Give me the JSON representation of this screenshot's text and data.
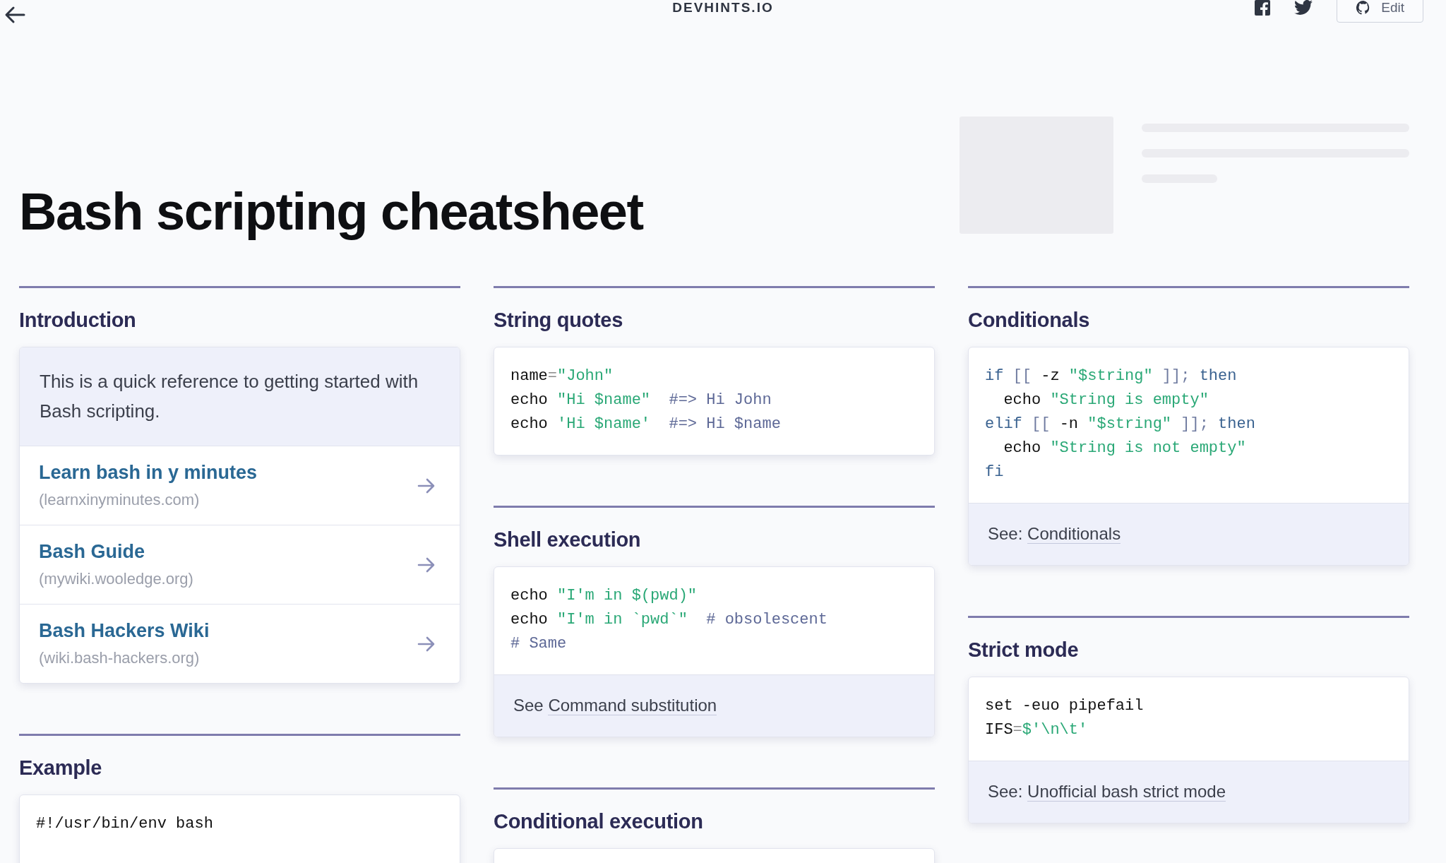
{
  "topbar": {
    "site": "DEVHINTS.IO",
    "edit_button": "Edit"
  },
  "title": "Bash scripting cheatsheet",
  "columns": [
    [
      {
        "kind": "intro",
        "title": "Introduction",
        "intro": "This is a quick reference to getting started with Bash scripting.",
        "links": [
          {
            "title": "Learn bash in y minutes",
            "source": "(learnxinyminutes.com)"
          },
          {
            "title": "Bash Guide",
            "source": "(mywiki.wooledge.org)"
          },
          {
            "title": "Bash Hackers Wiki",
            "source": "(wiki.bash-hackers.org)"
          }
        ]
      },
      {
        "kind": "code",
        "title": "Example",
        "code": [
          [
            {
              "kind": "plain",
              "text": "#!/usr/bin/env bash"
            }
          ]
        ]
      }
    ],
    [
      {
        "kind": "code",
        "title": "String quotes",
        "code": [
          [
            {
              "kind": "plain",
              "text": "name"
            },
            {
              "kind": "op",
              "text": "="
            },
            {
              "kind": "str",
              "text": "\"John\""
            }
          ],
          [
            {
              "kind": "plain",
              "text": "echo "
            },
            {
              "kind": "str",
              "text": "\"Hi $name\""
            },
            {
              "kind": "comment",
              "text": "  #=> Hi John"
            }
          ],
          [
            {
              "kind": "plain",
              "text": "echo "
            },
            {
              "kind": "str",
              "text": "'Hi $name'"
            },
            {
              "kind": "comment",
              "text": "  #=> Hi $name"
            }
          ]
        ]
      },
      {
        "kind": "code",
        "title": "Shell execution",
        "code": [
          [
            {
              "kind": "plain",
              "text": "echo "
            },
            {
              "kind": "str",
              "text": "\"I'm in $(pwd)\""
            }
          ],
          [
            {
              "kind": "plain",
              "text": "echo "
            },
            {
              "kind": "str",
              "text": "\"I'm in `pwd`\""
            },
            {
              "kind": "comment",
              "text": "  # obsolescent"
            }
          ],
          [
            {
              "kind": "comment",
              "text": "# Same"
            }
          ]
        ],
        "footer": {
          "prefix": "See ",
          "link": "Command substitution"
        }
      },
      {
        "kind": "code",
        "title": "Conditional execution"
      }
    ],
    [
      {
        "kind": "code",
        "title": "Conditionals",
        "code": [
          [
            {
              "kind": "kw",
              "text": "if"
            },
            {
              "kind": "punct",
              "text": " [[ "
            },
            {
              "kind": "plain",
              "text": "-z "
            },
            {
              "kind": "str",
              "text": "\"$string\""
            },
            {
              "kind": "punct",
              "text": " ]]; "
            },
            {
              "kind": "kw",
              "text": "then"
            }
          ],
          [
            {
              "kind": "plain",
              "text": "  echo "
            },
            {
              "kind": "str",
              "text": "\"String is empty\""
            }
          ],
          [
            {
              "kind": "kw",
              "text": "elif"
            },
            {
              "kind": "punct",
              "text": " [[ "
            },
            {
              "kind": "plain",
              "text": "-n "
            },
            {
              "kind": "str",
              "text": "\"$string\""
            },
            {
              "kind": "punct",
              "text": " ]]; "
            },
            {
              "kind": "kw",
              "text": "then"
            }
          ],
          [
            {
              "kind": "plain",
              "text": "  echo "
            },
            {
              "kind": "str",
              "text": "\"String is not empty\""
            }
          ],
          [
            {
              "kind": "kw",
              "text": "fi"
            }
          ]
        ],
        "footer": {
          "prefix": "See: ",
          "link": "Conditionals"
        }
      },
      {
        "kind": "code",
        "title": "Strict mode",
        "code": [
          [
            {
              "kind": "plain",
              "text": "set -euo pipefail"
            }
          ],
          [
            {
              "kind": "plain",
              "text": "IFS"
            },
            {
              "kind": "op",
              "text": "="
            },
            {
              "kind": "str",
              "text": "$'\\n\\t'"
            }
          ]
        ],
        "footer": {
          "prefix": "See: ",
          "link": "Unofficial bash strict mode"
        }
      }
    ]
  ]
}
